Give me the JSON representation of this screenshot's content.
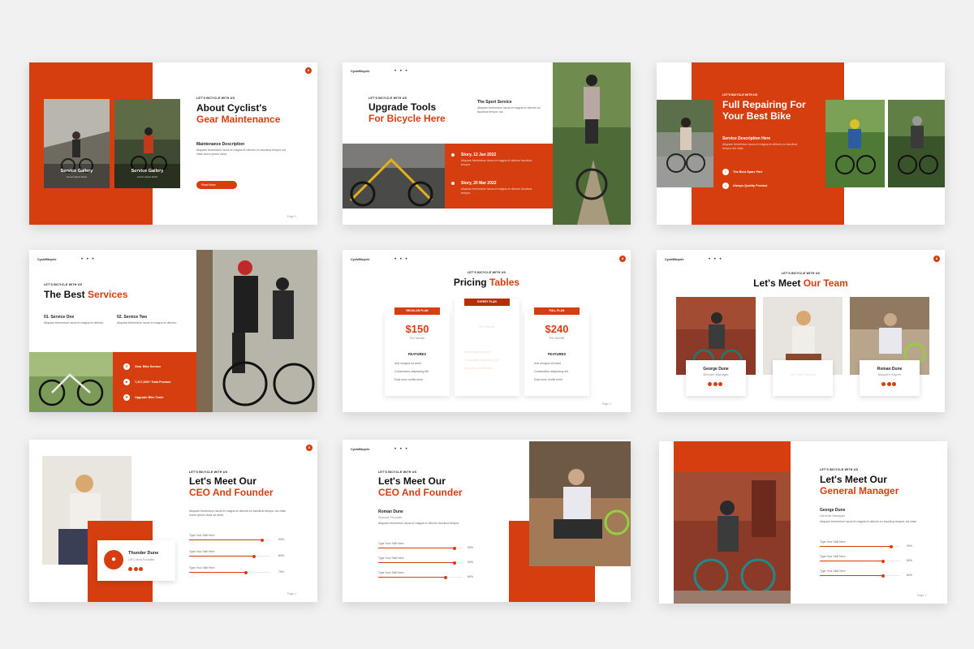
{
  "brand_logo": "CycleBicycle",
  "nav_dots": "• • •",
  "page_label": "Page 1",
  "slides": {
    "s1": {
      "eyebrow": "LET'S BICYCLE WITH US",
      "title_line1": "About Cyclist's",
      "title_line2": "Gear Maintenance",
      "subhead": "Maintenance Description",
      "body": "Aliquam fermentum lacus et magna et ultrices eu faucibus tempor dui vitae lorem ipsum dolor.",
      "button": "Read More",
      "gallery1_title": "Service Gallery",
      "gallery1_sub": "Lorem Ipsum Dolor",
      "gallery2_title": "Service Gallery",
      "gallery2_sub": "Lorem Ipsum Dolor",
      "badge": "8"
    },
    "s2": {
      "eyebrow": "LET'S BICYCLE WITH US",
      "title_line1": "Upgrade Tools",
      "title_line2": "For Bicycle Here",
      "service_title": "The Sport Service",
      "service_body": "Aliquam fermentum lacus et magna et ultrices eu faucibus tempor dui.",
      "story1_title": "Story, 12 Jan 2022",
      "story1_body": "Aliquam fermentum lacus et magna et ultrices faucibus tempor.",
      "story2_title": "Story, 20 Mar 2022",
      "story2_body": "Aliquam fermentum lacus et magna et ultrices faucibus tempor."
    },
    "s3": {
      "eyebrow": "LET'S BICYCLE WITH US",
      "title_line1": "Full Repairing For",
      "title_line2": "Your Best Bike",
      "subhead": "Service Description Here",
      "body": "Aliquam fermentum lacus et magna et ultrices eu faucibus tempor dui vitae.",
      "item1": "The Best Spare Part",
      "item2": "Always Quality Product"
    },
    "s4": {
      "eyebrow": "LET'S BICYCLE WITH US",
      "title_a": "The Best ",
      "title_b": "Services",
      "col1_title": "01. Service One",
      "col2_title": "02. Service Two",
      "col_body": "Aliquam fermentum lacus et magna et ultrices.",
      "item1": "Gear Bike Service",
      "item2": "7,317,330+ Total Product",
      "item3": "Upgrade Bike Tools"
    },
    "s5": {
      "eyebrow": "LET'S BICYCLE WITH US",
      "title_a": "Pricing ",
      "title_b": "Tables",
      "badge": "8",
      "plans": [
        {
          "name": "REGULAR PLAN",
          "price": "$150",
          "period": "Per Month",
          "features_label": "FEATURES",
          "features": [
            "Anti enegna sit amet",
            "Consectetur adipiscing elit",
            "Duis nunc mollis enim"
          ]
        },
        {
          "name": "EXPERT PLAN",
          "price": "$320",
          "period": "Per Month",
          "features_label": "FEATURES",
          "features": [
            "Anti enegna sit amet",
            "Consectetur adipiscing elit",
            "Duis nunc mollis enim"
          ]
        },
        {
          "name": "FULL PLAN",
          "price": "$240",
          "period": "Per Month",
          "features_label": "FEATURES",
          "features": [
            "Anti enegna sit amet",
            "Consectetur adipiscing elit",
            "Duis nunc mollis enim"
          ]
        }
      ]
    },
    "s6": {
      "eyebrow": "LET'S BICYCLE WITH US",
      "title_a": "Let's Meet ",
      "title_b": "Our Team",
      "badge": "8",
      "members": [
        {
          "name": "George Dune",
          "role": "Director Manager"
        },
        {
          "name": "Thunder Dune",
          "role": "CEO And Founder"
        },
        {
          "name": "Roman Dune",
          "role": "Bicycle's Expert"
        }
      ]
    },
    "s7": {
      "eyebrow": "LET'S BICYCLE WITH US",
      "title_line1": "Let's Meet Our",
      "title_line2": "CEO And Founder",
      "body": "Aliquam fermentum lacus et magna et ultrices eu faucibus tempor dui vitae lorem ipsum dolor sit amet.",
      "name": "Thunder Dune",
      "role": "CEO And Founder",
      "badge": "8",
      "skills": [
        {
          "label": "Type Your Skill Here",
          "value": 0.9,
          "pct": "90%"
        },
        {
          "label": "Type Your Skill Here",
          "value": 0.8,
          "pct": "80%"
        },
        {
          "label": "Type Your Skill Here",
          "value": 0.7,
          "pct": "70%"
        }
      ]
    },
    "s8": {
      "eyebrow": "LET'S BICYCLE WITH US",
      "title_line1": "Let's Meet Our",
      "title_line2": "CEO And Founder",
      "name": "Roman Dune",
      "role": "Spouse Founder",
      "body": "Aliquam fermentum lacus et magna et ultrices faucibus tempor.",
      "skills": [
        {
          "label": "Type Your Skill Here",
          "value": 0.9,
          "pct": "90%"
        },
        {
          "label": "Type Your Skill Here",
          "value": 0.9,
          "pct": "90%"
        },
        {
          "label": "Type Your Skill Here",
          "value": 0.8,
          "pct": "80%"
        }
      ]
    },
    "s9": {
      "eyebrow": "LET'S BICYCLE WITH US",
      "title_line1": "Let's Meet Our",
      "title_line2": "General Manager",
      "name": "George Dune",
      "role": "General Manager",
      "body": "Aliquam fermentum lacus et magna et ultrices eu faucibus tempor dui vitae.",
      "skills": [
        {
          "label": "Type Your Skill Here",
          "value": 0.9,
          "pct": "90%"
        },
        {
          "label": "Type Your Skill Here",
          "value": 0.8,
          "pct": "80%"
        },
        {
          "label": "Type Your Skill Here",
          "value": 0.8,
          "pct": "80%"
        }
      ]
    }
  },
  "colors": {
    "accent": "#d63e10",
    "background": "#f1f1f1",
    "slide": "#ffffff"
  }
}
